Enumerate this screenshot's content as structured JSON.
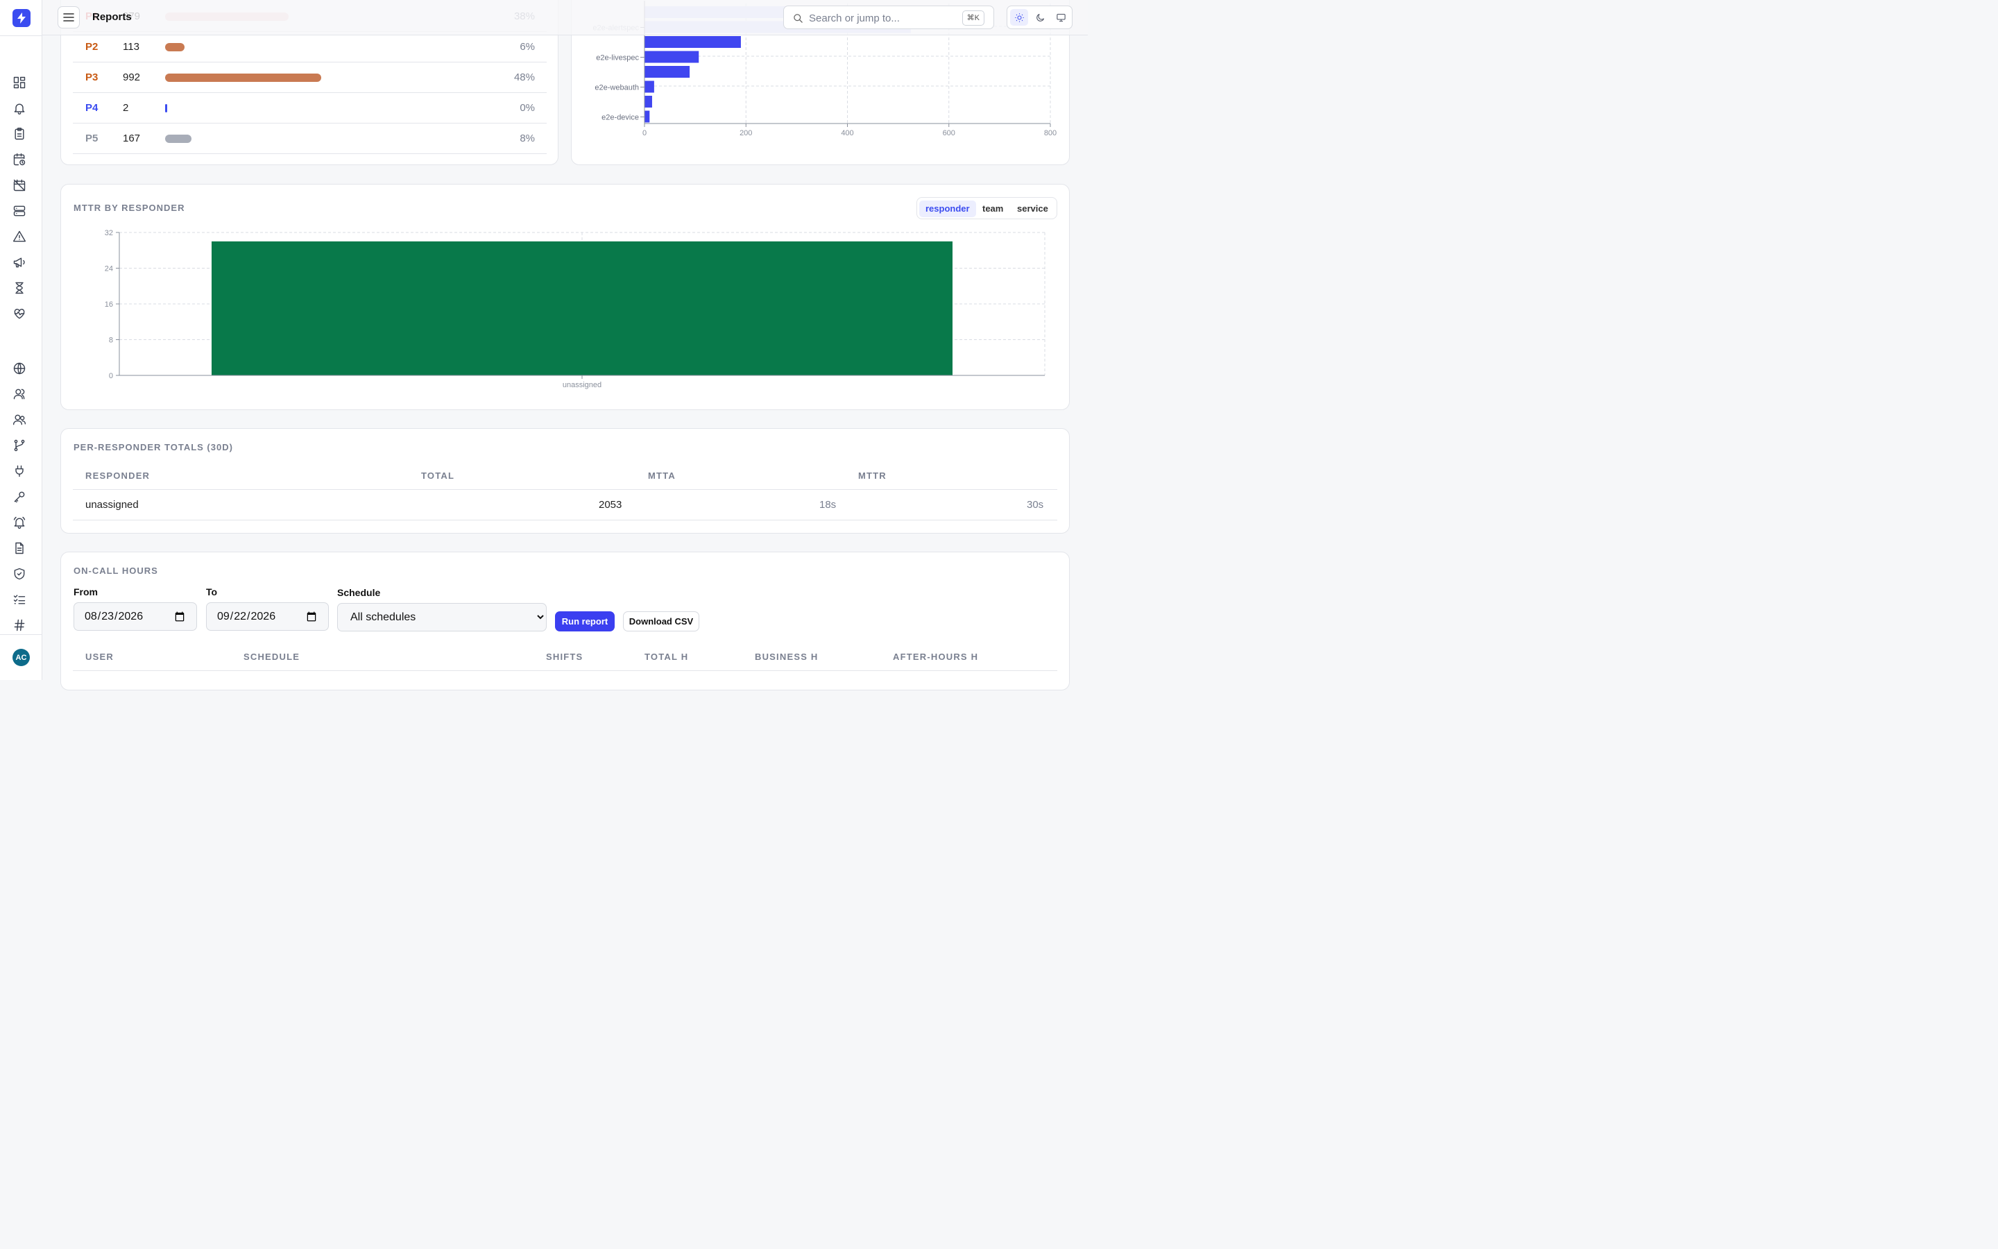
{
  "topbar": {
    "title": "Reports",
    "search_placeholder": "Search or jump to...",
    "search_shortcut": "⌘K"
  },
  "user": {
    "initials": "AC"
  },
  "priority": {
    "rows": [
      {
        "label": "P1",
        "count": "279",
        "pct": "38%",
        "fraction": 0.38,
        "color": "#e05050",
        "bar_color": "#f5cfcf"
      },
      {
        "label": "P2",
        "count": "113",
        "pct": "6%",
        "fraction": 0.06,
        "color": "#c85a14",
        "bar_color": "#c97a52"
      },
      {
        "label": "P3",
        "count": "992",
        "pct": "48%",
        "fraction": 0.48,
        "color": "#c85a14",
        "bar_color": "#c97a52"
      },
      {
        "label": "P4",
        "count": "2",
        "pct": "0%",
        "fraction": 0.0,
        "color": "#3b4cf0",
        "bar_color": "#3b4cf0"
      },
      {
        "label": "P5",
        "count": "167",
        "pct": "8%",
        "fraction": 0.08,
        "color": "#8a909c",
        "bar_color": "#a8adb8"
      }
    ]
  },
  "service_chart": {
    "chart_data": {
      "type": "bar",
      "orientation": "horizontal",
      "categories": [
        "",
        "e2e-alertspec",
        "",
        "e2e-livespec",
        "",
        "e2e-webauth",
        "",
        "e2e-device"
      ],
      "values": [
        685,
        525,
        190,
        107,
        89,
        19,
        15,
        10
      ],
      "tick_labels": [
        "e2e-alertspec",
        "e2e-livespec",
        "e2e-webauth",
        "e2e-device"
      ],
      "x_ticks": [
        "0",
        "200",
        "400",
        "600",
        "800"
      ],
      "xlim": [
        0,
        800
      ],
      "grid": true
    }
  },
  "mttr": {
    "title": "MTTR BY RESPONDER",
    "tabs": [
      "responder",
      "team",
      "service"
    ],
    "active_tab": "responder",
    "chart_data": {
      "type": "bar",
      "categories": [
        "unassigned"
      ],
      "values": [
        30
      ],
      "y_ticks": [
        "0",
        "8",
        "16",
        "24",
        "32"
      ],
      "ylim": [
        0,
        32
      ],
      "grid": true,
      "color": "#08794a"
    }
  },
  "totals": {
    "title": "PER-RESPONDER TOTALS (30D)",
    "columns": [
      "RESPONDER",
      "TOTAL",
      "MTTA",
      "MTTR"
    ],
    "rows": [
      {
        "responder": "unassigned",
        "total": "2053",
        "mtta": "18s",
        "mttr": "30s"
      }
    ]
  },
  "oncall": {
    "title": "ON-CALL HOURS",
    "from_label": "From",
    "to_label": "To",
    "schedule_label": "Schedule",
    "from_value": "2026-08-23",
    "to_value": "2026-09-22",
    "schedule_value": "All schedules",
    "run_label": "Run report",
    "csv_label": "Download CSV",
    "columns": [
      "USER",
      "SCHEDULE",
      "SHIFTS",
      "TOTAL H",
      "BUSINESS H",
      "AFTER-HOURS H"
    ]
  },
  "colors": {
    "accent": "#3b4cf0",
    "chart_bar": "#4046f0",
    "chart_bar_faded": "#d4d7fb"
  },
  "sidebar": {
    "icons": [
      "dashboard-icon",
      "bell-icon",
      "clipboard-icon",
      "calendar-clock-icon",
      "calendar-off-icon",
      "server-icon",
      "alert-triangle-icon",
      "megaphone-icon",
      "hourglass-icon",
      "heart-pulse-icon",
      "globe-icon",
      "user-icon",
      "users-icon",
      "git-branch-icon",
      "plug-icon",
      "key-icon",
      "bell-ring-icon",
      "file-text-icon",
      "shield-check-icon",
      "list-checks-icon",
      "hash-icon"
    ]
  }
}
